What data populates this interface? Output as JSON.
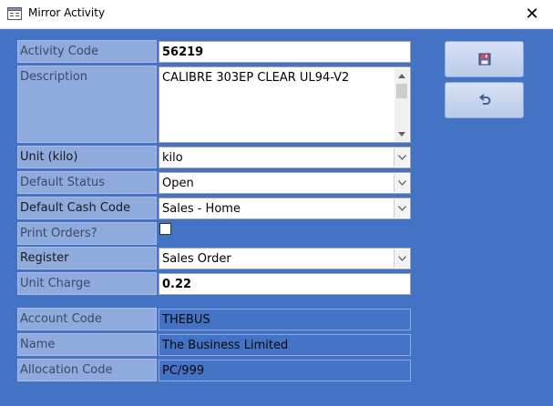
{
  "window": {
    "title": "Mirror Activity",
    "close_label": "✕"
  },
  "toolbar": {
    "save_icon": "save-icon",
    "undo_icon": "undo-icon"
  },
  "form": {
    "activity_code": {
      "label": "Activity Code",
      "value": "56219"
    },
    "description": {
      "label": "Description",
      "value": "CALIBRE 303EP CLEAR UL94-V2"
    },
    "unit": {
      "label": "Unit (kilo)",
      "value": "kilo"
    },
    "default_status": {
      "label": "Default Status",
      "value": "Open"
    },
    "default_cash_code": {
      "label": "Default Cash Code",
      "value": "Sales - Home"
    },
    "print_orders": {
      "label": "Print Orders?",
      "checked": false
    },
    "register": {
      "label": "Register",
      "value": "Sales Order"
    },
    "unit_charge": {
      "label": "Unit Charge",
      "value": "0.22"
    },
    "account_code": {
      "label": "Account Code",
      "value": "THEBUS"
    },
    "name": {
      "label": "Name",
      "value": "The Business Limited"
    },
    "allocation_code": {
      "label": "Allocation Code",
      "value": "PC/999"
    }
  },
  "colors": {
    "background": "#4472c4",
    "label_bg": "#8faadc",
    "button_bg": "#c5d3ee"
  }
}
